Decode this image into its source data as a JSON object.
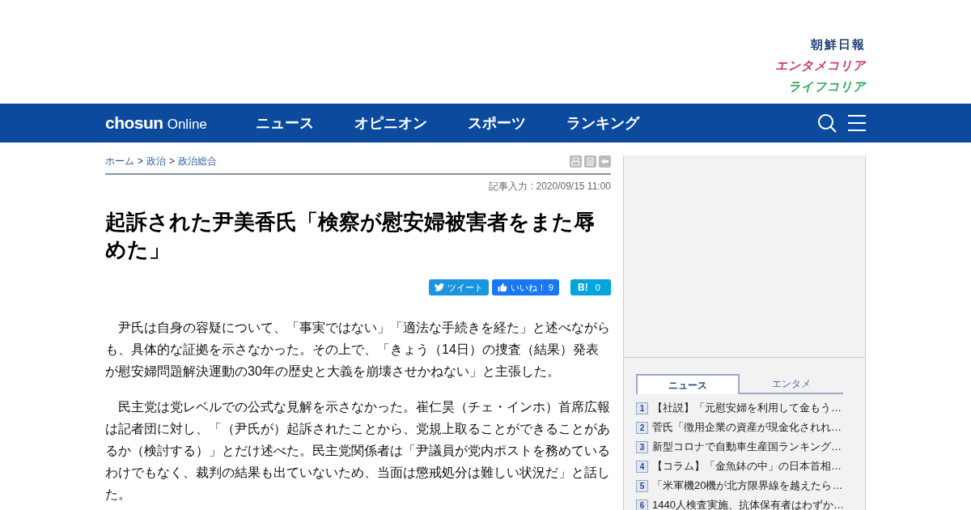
{
  "brand_links": [
    {
      "label": "朝鮮日報",
      "color": "#1e3f7a"
    },
    {
      "label": "エンタメコリア",
      "color": "#d0366a"
    },
    {
      "label": "ライフコリア",
      "color": "#2fa855"
    }
  ],
  "nav": {
    "logo_bold": "chosun",
    "logo_light": "Online",
    "items": [
      "ニュース",
      "オピニオン",
      "スポーツ",
      "ランキング"
    ]
  },
  "breadcrumb": [
    "ホーム",
    "政治",
    "政治総合"
  ],
  "breadcrumb_separator": ">",
  "timestamp": "記事入力 : 2020/09/15 11:00",
  "headline": "起訴された尹美香氏「検察が慰安婦被害者をまた辱めた」",
  "share": [
    {
      "kind": "tweet",
      "label": "ツイート"
    },
    {
      "kind": "like",
      "label": "いいね！ 9"
    },
    {
      "kind": "hatena",
      "label": "B!",
      "count": "0"
    }
  ],
  "paragraphs": [
    "　尹氏は自身の容疑について、「事実ではない」「適法な手続きを経た」と述べながらも、具体的な証拠を示さなかった。その上で、「きょう（14日）の捜査（結果）発表が慰安婦問題解決運動の30年の歴史と大義を崩壊させかねない」と主張した。",
    "　民主党は党レベルでの公式な見解を示さなかった。崔仁昊（チェ・インホ）首席広報は記者団に対し、「（尹氏が）起訴されたことから、党規上取ることができることがあるか（検討する）」とだけ述べた。民主党関係者は「尹議員が党内ポストを務めているわけでもなく、裁判の結果も出ていないため、当面は懲戒処分は難しい状況だ」と話した。"
  ],
  "ranking": {
    "tabs": [
      {
        "label": "ニュース",
        "selected": true
      },
      {
        "label": "エンタメ",
        "selected": false
      }
    ],
    "items": [
      {
        "rank": "1",
        "title": "【社説】「元慰安婦を利用して金もう…"
      },
      {
        "rank": "2",
        "title": "菅氏「徴用企業の資産が現金化されれ…"
      },
      {
        "rank": "3",
        "title": "新型コロナで自動車生産国ランキング…"
      },
      {
        "rank": "4",
        "title": "【コラム】「金魚鉢の中」の日本首相…"
      },
      {
        "rank": "5",
        "title": "「米軍機20機が北方限界線を越えたら…"
      },
      {
        "rank": "6",
        "title": "1440人検査実施、抗体保有者はわずか…"
      }
    ]
  }
}
